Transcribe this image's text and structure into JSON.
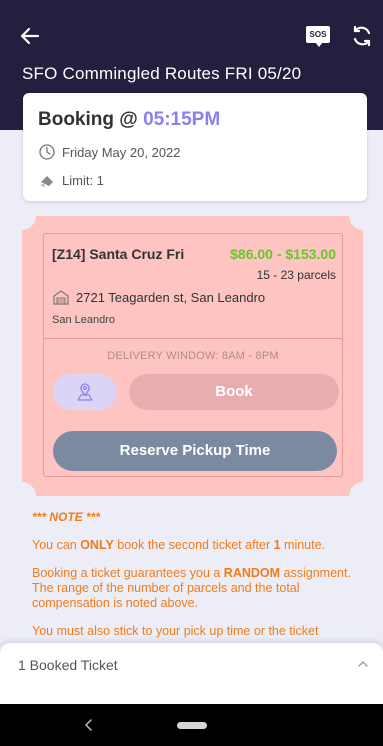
{
  "header": {
    "title": "SFO Commingled Routes FRI 05/20",
    "sos_label": "SOS",
    "icons": {
      "back": "arrow-left-icon",
      "sos": "sos-icon",
      "refresh": "refresh-icon"
    }
  },
  "booking": {
    "label": "Booking @ ",
    "time": "05:15PM",
    "date": "Friday May 20, 2022",
    "limit": "Limit: 1"
  },
  "route": {
    "name": "[Z14] Santa Cruz Fri",
    "price_range": "$86.00 - $153.00",
    "parcels": "15 - 23 parcels",
    "address": "2721 Teagarden st, San Leandro",
    "city": "San Leandro",
    "delivery_window": "DELIVERY WINDOW: 8AM - 8PM",
    "book_label": "Book",
    "reserve_label": "Reserve Pickup Time"
  },
  "note": {
    "heading": "*** NOTE ***",
    "p1_pre": "You can ",
    "p1_bold": "ONLY",
    "p1_mid": " book the second ticket after ",
    "p1_num": "1",
    "p1_post": " minute.",
    "p2_pre": "Booking a ticket guarantees you a ",
    "p2_bold": "RANDOM",
    "p2_post": " assignment. The range of the number of parcels and the total compensation is noted above.",
    "p3": "You must also stick to your pick up time or the ticket"
  },
  "bottom_sheet": {
    "label": "1 Booked Ticket"
  },
  "colors": {
    "header_bg": "#231f3f",
    "accent_purple": "#8b7ff2",
    "price_green": "#6cc52c",
    "ticket_pink": "#fdc4c1",
    "note_orange": "#ef7c1c",
    "reserve_button": "#7b8aa0"
  }
}
